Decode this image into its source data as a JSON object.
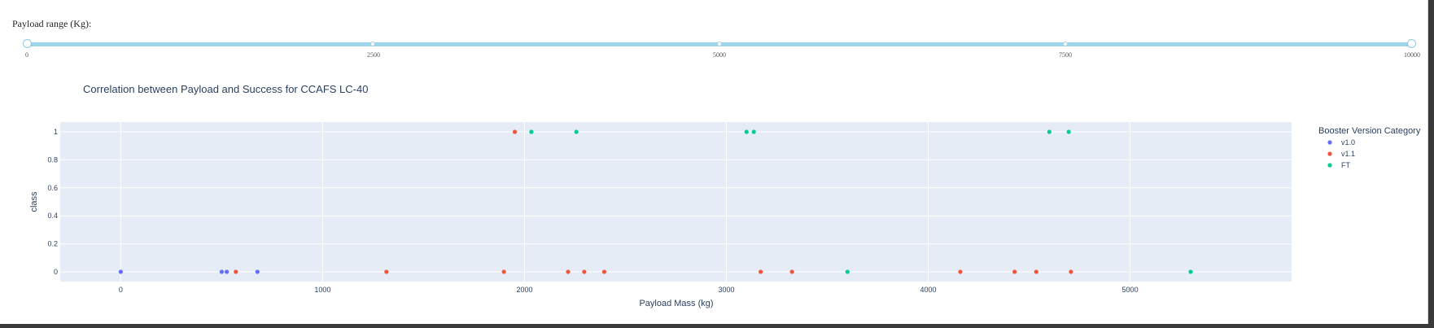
{
  "slider": {
    "label": "Payload range (Kg):",
    "marks": [
      "0",
      "2500",
      "5000",
      "7500",
      "10000"
    ],
    "range": [
      0,
      10000
    ]
  },
  "chart_data": {
    "type": "scatter",
    "title": "Correlation between Payload and Success for CCAFS LC-40",
    "xlabel": "Payload Mass (kg)",
    "ylabel": "class",
    "xlim": [
      -300,
      5800
    ],
    "ylim": [
      -0.07,
      1.07
    ],
    "xticks": [
      0,
      1000,
      2000,
      3000,
      4000,
      5000
    ],
    "xtick_labels": [
      "0",
      "1000",
      "2000",
      "3000",
      "4000",
      "5000"
    ],
    "yticks": [
      0,
      0.2,
      0.4,
      0.6,
      0.8,
      1
    ],
    "ytick_labels": [
      "0",
      "0.2",
      "0.4",
      "0.6",
      "0.8",
      "1"
    ],
    "grid": true,
    "legend_title": "Booster Version Category",
    "legend_position": "top-right",
    "series": [
      {
        "name": "v1.0",
        "color": "#636efa",
        "x": [
          0,
          500,
          525,
          677
        ],
        "y": [
          0,
          0,
          0,
          0
        ]
      },
      {
        "name": "v1.1",
        "color": "#ef553b",
        "x": [
          570,
          1316,
          1898,
          1952,
          2216,
          2296,
          2395,
          3170,
          3325,
          4159,
          4428,
          4535,
          4707
        ],
        "y": [
          0,
          0,
          0,
          1,
          0,
          0,
          0,
          0,
          0,
          0,
          0,
          0,
          0
        ]
      },
      {
        "name": "FT",
        "color": "#00cc96",
        "x": [
          2034,
          2257,
          3100,
          3136,
          3600,
          4600,
          4696,
          5300
        ],
        "y": [
          1,
          1,
          1,
          1,
          0,
          1,
          1,
          0
        ]
      }
    ]
  }
}
